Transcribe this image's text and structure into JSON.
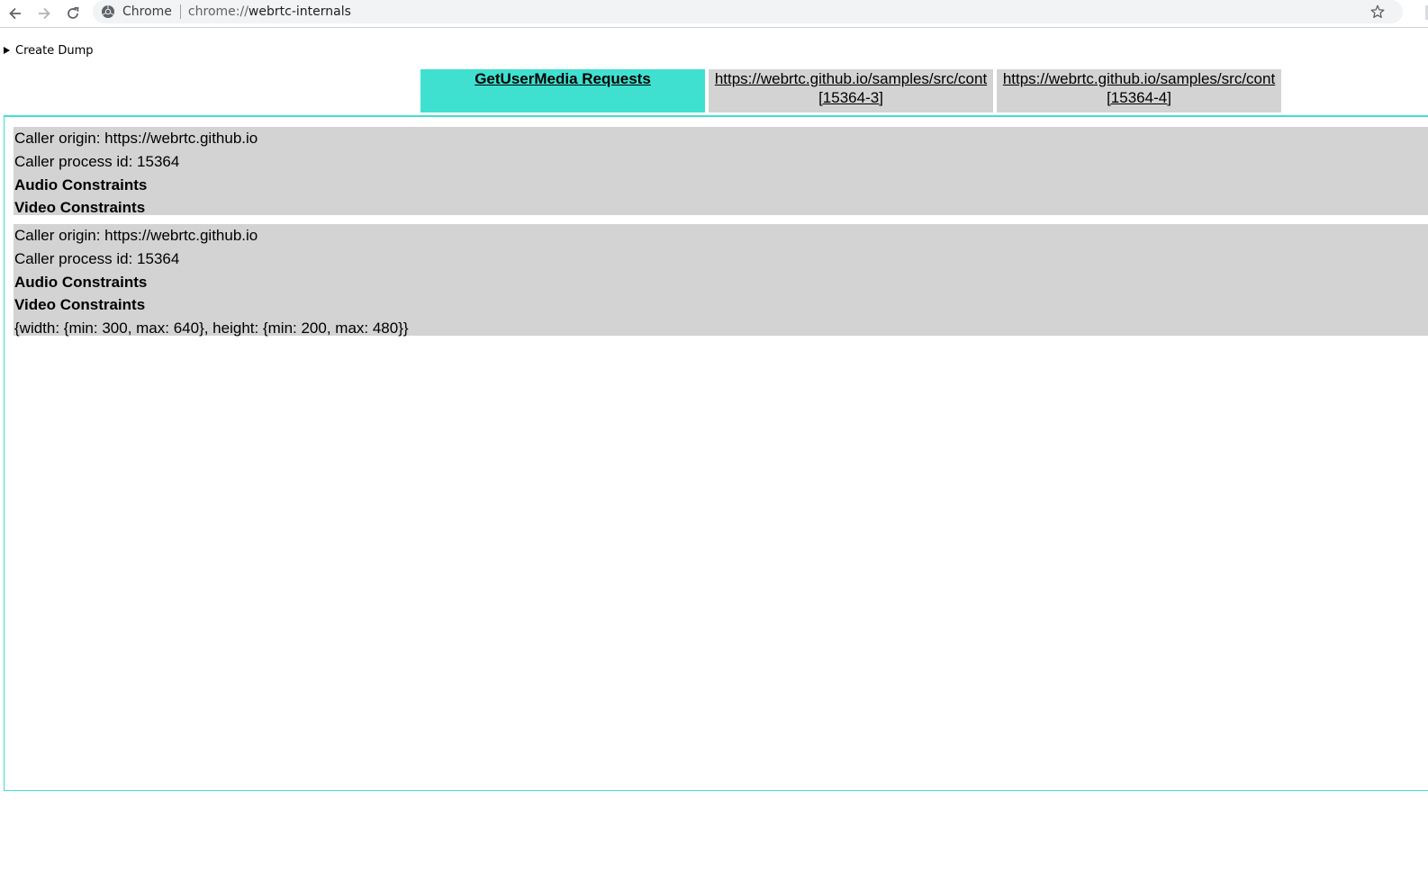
{
  "browser": {
    "site_chip": "Chrome",
    "url_scheme": "chrome://",
    "url_host": "webrtc-internals"
  },
  "dump": {
    "label": "Create Dump"
  },
  "tabs": [
    {
      "label": "GetUserMedia Requests",
      "selected": true
    },
    {
      "line1": "https://webrtc.github.io/samples/src/cont",
      "line2": "[15364-3]"
    },
    {
      "line1": "https://webrtc.github.io/samples/src/cont",
      "line2": "[15364-4]"
    }
  ],
  "requests": [
    {
      "origin": "Caller origin: https://webrtc.github.io",
      "pid": "Caller process id: 15364",
      "audio_heading": "Audio Constraints",
      "video_heading": "Video Constraints"
    },
    {
      "origin": "Caller origin: https://webrtc.github.io",
      "pid": "Caller process id: 15364",
      "audio_heading": "Audio Constraints",
      "video_heading": "Video Constraints",
      "video_value": "{width: {min: 300, max: 640}, height: {min: 200, max: 480}}"
    }
  ],
  "colors": {
    "accent": "#40e0d0",
    "tab_bg": "#d3d3d3"
  },
  "icons": [
    "back-icon",
    "forward-icon",
    "reload-icon",
    "chrome-icon",
    "star-icon"
  ]
}
